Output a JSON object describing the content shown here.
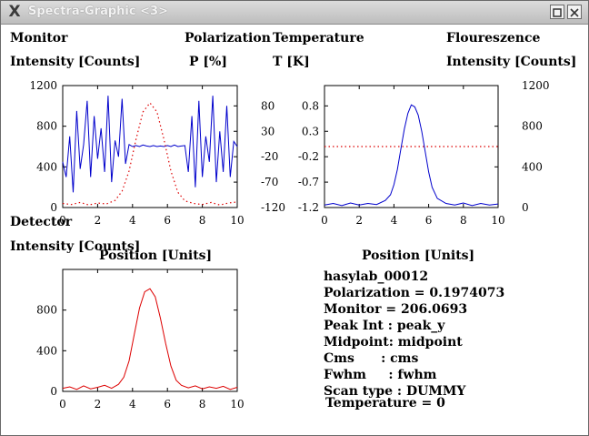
{
  "window": {
    "title": "Spectra-Graphic <3>",
    "app_icon": "x-logo-icon",
    "controls": [
      "maximize-icon",
      "close-icon"
    ]
  },
  "labels": {
    "monitor": "Monitor",
    "monitor_unit": "Intensity [Counts]",
    "polarization": "Polarization",
    "polarization_unit": "P [%]",
    "temperature": "Temperature",
    "temperature_unit": "T [K]",
    "fluorescence": "Floureszence",
    "fluorescence_unit": "Intensity [Counts]",
    "detector": "Detector",
    "detector_unit": "Intensity [Counts]",
    "position_top_left": "Position [Units]",
    "position_top_right": "Position [Units]"
  },
  "info": {
    "lines": [
      "hasylab_00012",
      "Polarization = 0.1974073",
      "Monitor = 206.0693",
      "Peak Int : peak_y",
      "Midpoint: midpoint",
      "Cms      : cms",
      "Fwhm     : fwhm",
      "Scan type : DUMMY",
      "Temperature = 0"
    ]
  },
  "colors": {
    "monitor": "#0000cc",
    "polarization": "#dd0000",
    "temperature": "#0000cc",
    "fluorescence": "#dd0000",
    "detector": "#dd0000"
  },
  "chart_data": [
    {
      "type": "line",
      "panel": "top-left",
      "xlim": [
        0,
        10
      ],
      "xticks": [
        0,
        2,
        4,
        6,
        8,
        10
      ],
      "left_axis": {
        "label": "Intensity [Counts]",
        "ylim": [
          0,
          1200
        ],
        "ticks": [
          0,
          400,
          800,
          1200
        ]
      },
      "right_axis": {
        "label": "P [%]",
        "ylim": [
          -120,
          120
        ],
        "ticks": [
          -120,
          -70,
          -20,
          30,
          80
        ]
      },
      "series": [
        {
          "name": "Monitor",
          "axis": "left",
          "style": "solid",
          "x": [
            0,
            0.2,
            0.4,
            0.6,
            0.8,
            1.0,
            1.2,
            1.4,
            1.6,
            1.8,
            2.0,
            2.2,
            2.4,
            2.6,
            2.8,
            3.0,
            3.2,
            3.4,
            3.6,
            3.8,
            4.0,
            4.2,
            4.4,
            4.6,
            4.8,
            5.0,
            5.2,
            5.4,
            5.6,
            5.8,
            6.0,
            6.2,
            6.4,
            6.6,
            6.8,
            7.0,
            7.2,
            7.4,
            7.6,
            7.8,
            8.0,
            8.2,
            8.4,
            8.6,
            8.8,
            9.0,
            9.2,
            9.4,
            9.6,
            9.8,
            10.0
          ],
          "y": [
            450,
            300,
            700,
            150,
            950,
            380,
            620,
            1050,
            300,
            900,
            480,
            780,
            350,
            1100,
            250,
            660,
            500,
            1070,
            430,
            620,
            600,
            610,
            600,
            615,
            605,
            600,
            610,
            600,
            605,
            600,
            610,
            600,
            615,
            600,
            605,
            610,
            350,
            900,
            200,
            1050,
            300,
            700,
            450,
            1100,
            250,
            750,
            350,
            1000,
            300,
            650,
            600
          ]
        },
        {
          "name": "Polarization",
          "axis": "right",
          "style": "dotted",
          "x": [
            0,
            0.5,
            1.0,
            1.5,
            2.0,
            2.5,
            3.0,
            3.4,
            3.8,
            4.2,
            4.6,
            5.0,
            5.4,
            5.8,
            6.2,
            6.6,
            7.0,
            7.5,
            8.0,
            8.5,
            9.0,
            9.5,
            10.0
          ],
          "y": [
            -112,
            -114,
            -110,
            -115,
            -111,
            -113,
            -106,
            -88,
            -48,
            14,
            68,
            86,
            68,
            14,
            -48,
            -90,
            -107,
            -112,
            -114,
            -110,
            -115,
            -111,
            -109
          ]
        }
      ]
    },
    {
      "type": "line",
      "panel": "top-right",
      "xlim": [
        0,
        10
      ],
      "xticks": [
        0,
        2,
        4,
        6,
        8,
        10
      ],
      "left_axis": {
        "label": "T [K]",
        "ylim": [
          -1.2,
          1.2
        ],
        "ticks": [
          -1.2,
          -0.7,
          -0.2,
          0.3,
          0.8
        ]
      },
      "right_axis": {
        "label": "Intensity [Counts]",
        "ylim": [
          0,
          1200
        ],
        "ticks": [
          0,
          400,
          800,
          1200
        ]
      },
      "series": [
        {
          "name": "Temperature",
          "axis": "left",
          "style": "solid",
          "x": [
            0,
            0.5,
            1.0,
            1.5,
            2.0,
            2.5,
            3.0,
            3.5,
            3.8,
            4.0,
            4.2,
            4.4,
            4.6,
            4.8,
            5.0,
            5.2,
            5.4,
            5.6,
            5.8,
            6.0,
            6.2,
            6.5,
            7.0,
            7.5,
            8.0,
            8.5,
            9.0,
            9.5,
            10.0
          ],
          "y": [
            -1.15,
            -1.12,
            -1.16,
            -1.11,
            -1.15,
            -1.12,
            -1.14,
            -1.06,
            -0.95,
            -0.75,
            -0.45,
            -0.05,
            0.35,
            0.65,
            0.82,
            0.78,
            0.62,
            0.3,
            -0.1,
            -0.5,
            -0.8,
            -1.02,
            -1.12,
            -1.15,
            -1.11,
            -1.16,
            -1.12,
            -1.15,
            -1.13
          ]
        },
        {
          "name": "Floureszence",
          "axis": "right",
          "style": "dotted",
          "x": [
            0,
            10
          ],
          "y": [
            600,
            600
          ]
        }
      ]
    },
    {
      "type": "line",
      "panel": "bottom-left",
      "xlim": [
        0,
        10
      ],
      "xticks": [
        0,
        2,
        4,
        6,
        8,
        10
      ],
      "left_axis": {
        "label": "Intensity [Counts]",
        "ylim": [
          0,
          1200
        ],
        "ticks": [
          0,
          400,
          800
        ]
      },
      "series": [
        {
          "name": "Detector",
          "axis": "left",
          "style": "solid",
          "x": [
            0,
            0.4,
            0.8,
            1.2,
            1.6,
            2.0,
            2.4,
            2.8,
            3.2,
            3.5,
            3.8,
            4.1,
            4.4,
            4.7,
            5.0,
            5.3,
            5.6,
            5.9,
            6.2,
            6.5,
            6.8,
            7.2,
            7.6,
            8.0,
            8.4,
            8.8,
            9.2,
            9.6,
            10.0
          ],
          "y": [
            30,
            45,
            20,
            55,
            25,
            40,
            60,
            30,
            70,
            140,
            300,
            560,
            820,
            980,
            1010,
            930,
            720,
            470,
            250,
            110,
            60,
            35,
            55,
            25,
            45,
            30,
            50,
            20,
            40
          ]
        }
      ]
    }
  ]
}
